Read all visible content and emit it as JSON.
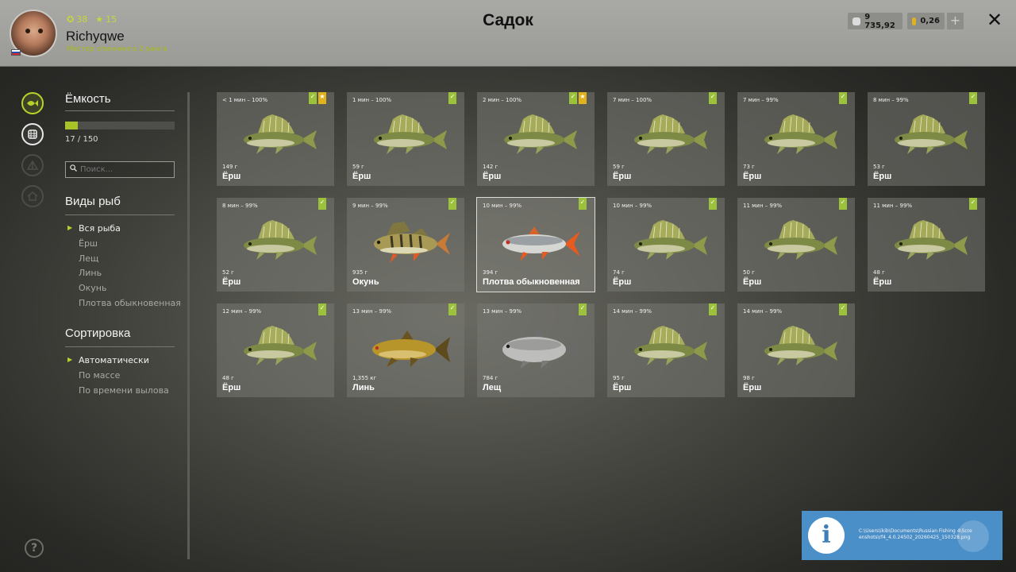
{
  "header": {
    "title": "Садок",
    "username": "Richyqwe",
    "rank": "Мастер спиннинга 2 ранга",
    "level": "38",
    "stars": "15",
    "silver": "9 735,92",
    "gold": "0,26",
    "plus_label": "+",
    "close_label": "✕"
  },
  "capacity": {
    "title": "Ёмкость",
    "current": 17,
    "max": 150,
    "text": "17 / 150"
  },
  "search": {
    "placeholder": "Поиск..."
  },
  "species": {
    "title": "Виды рыб",
    "items": [
      "Вся рыба",
      "Ёрш",
      "Лещ",
      "Линь",
      "Окунь",
      "Плотва обыкновенная"
    ],
    "selected": 0
  },
  "sorting": {
    "title": "Сортировка",
    "items": [
      "Автоматически",
      "По массе",
      "По времени вылова"
    ],
    "selected": 0
  },
  "fish": [
    {
      "time": "< 1 мин – 100%",
      "weight": "149 г",
      "name": "Ёрш",
      "kind": "ruffe",
      "badges": [
        "green",
        "gold"
      ]
    },
    {
      "time": "1 мин – 100%",
      "weight": "59 г",
      "name": "Ёрш",
      "kind": "ruffe",
      "badges": [
        "green"
      ]
    },
    {
      "time": "2 мин – 100%",
      "weight": "142 г",
      "name": "Ёрш",
      "kind": "ruffe",
      "badges": [
        "green",
        "gold"
      ]
    },
    {
      "time": "7 мин – 100%",
      "weight": "59 г",
      "name": "Ёрш",
      "kind": "ruffe",
      "badges": [
        "green"
      ]
    },
    {
      "time": "7 мин – 99%",
      "weight": "73 г",
      "name": "Ёрш",
      "kind": "ruffe",
      "badges": [
        "green"
      ]
    },
    {
      "time": "8 мин – 99%",
      "weight": "53 г",
      "name": "Ёрш",
      "kind": "ruffe",
      "badges": [
        "green"
      ]
    },
    {
      "time": "8 мин – 99%",
      "weight": "52 г",
      "name": "Ёрш",
      "kind": "ruffe",
      "badges": [
        "green"
      ]
    },
    {
      "time": "9 мин – 99%",
      "weight": "935 г",
      "name": "Окунь",
      "kind": "perch",
      "badges": [
        "green"
      ]
    },
    {
      "time": "10 мин – 99%",
      "weight": "394 г",
      "name": "Плотва обыкновенная",
      "kind": "roach",
      "badges": [
        "green"
      ],
      "selected": true
    },
    {
      "time": "10 мин – 99%",
      "weight": "74 г",
      "name": "Ёрш",
      "kind": "ruffe",
      "badges": [
        "green"
      ]
    },
    {
      "time": "11 мин – 99%",
      "weight": "50 г",
      "name": "Ёрш",
      "kind": "ruffe",
      "badges": [
        "green"
      ]
    },
    {
      "time": "11 мин – 99%",
      "weight": "48 г",
      "name": "Ёрш",
      "kind": "ruffe",
      "badges": [
        "green"
      ]
    },
    {
      "time": "12 мин – 99%",
      "weight": "48 г",
      "name": "Ёрш",
      "kind": "ruffe",
      "badges": [
        "green"
      ]
    },
    {
      "time": "13 мин – 99%",
      "weight": "1,355 кг",
      "name": "Линь",
      "kind": "tench",
      "badges": [
        "green"
      ]
    },
    {
      "time": "13 мин – 99%",
      "weight": "784 г",
      "name": "Лещ",
      "kind": "bream",
      "badges": [
        "green"
      ]
    },
    {
      "time": "14 мин – 99%",
      "weight": "95 г",
      "name": "Ёрш",
      "kind": "ruffe",
      "badges": [
        "green"
      ]
    },
    {
      "time": "14 мин – 99%",
      "weight": "98 г",
      "name": "Ёрш",
      "kind": "ruffe",
      "badges": [
        "green"
      ]
    }
  ],
  "notification": {
    "icon": "i",
    "message": "C:\\Users\\ikib\\Documents\\Russian Fishing 4\\Screenshots\\rf4_4.0.24502_20260425_150328.png"
  },
  "icons": [
    "fish-icon",
    "keepnet-icon",
    "tent-icon",
    "home-icon",
    "help-icon"
  ],
  "colors": {
    "accent": "#b7d32a",
    "badge_green": "#9bc23a",
    "badge_gold": "#e0b21e",
    "notify_blue": "#4b8fc9"
  }
}
